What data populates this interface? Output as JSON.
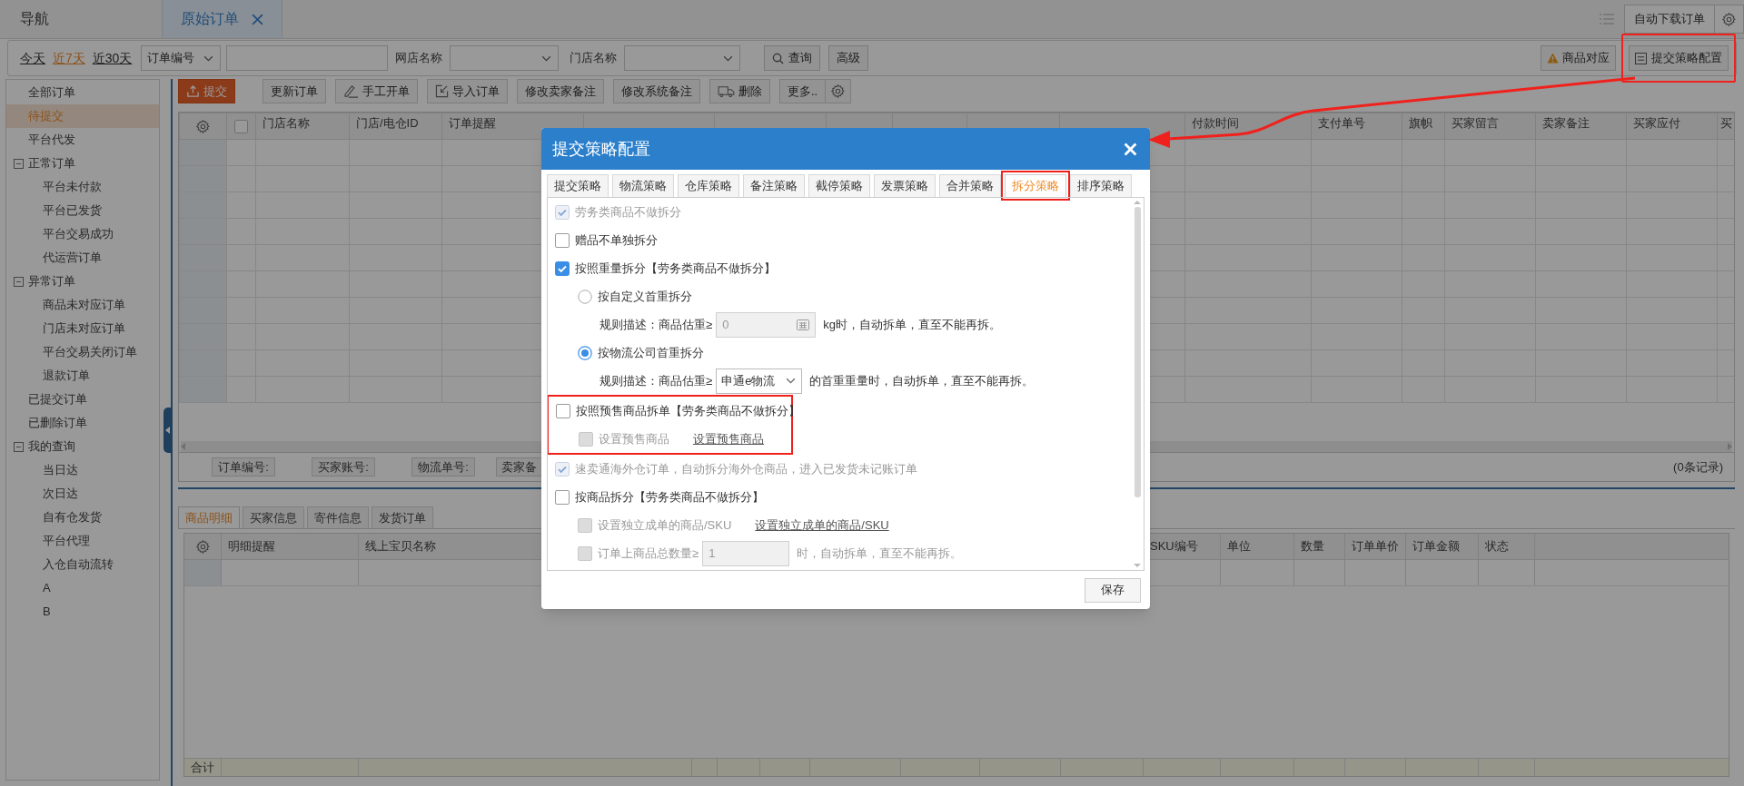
{
  "top_tabs": [
    {
      "label": "导航",
      "selected": false,
      "closable": false
    },
    {
      "label": "原始订单",
      "selected": true,
      "closable": true
    }
  ],
  "top_right": {
    "download_button": "自动下载订单"
  },
  "filter_bar": {
    "date_ranges": [
      {
        "label": "今天",
        "selected": false
      },
      {
        "label": "近7天",
        "selected": true
      },
      {
        "label": "近30天",
        "selected": false
      }
    ],
    "search_type": "订单编号",
    "shop_label": "网店名称",
    "store_label": "门店名称",
    "query_button": "查询",
    "advanced_button": "高级",
    "mapping_button": "商品对应",
    "strategy_button": {
      "label": "提交策略配置",
      "highlighted": true
    }
  },
  "sidebar": {
    "items": [
      {
        "label": "全部订单",
        "selected": false
      },
      {
        "label": "待提交",
        "selected": true
      },
      {
        "label": "平台代发",
        "selected": false
      },
      {
        "label": "正常订单",
        "selected": false,
        "expanded": true,
        "children": [
          {
            "label": "平台未付款",
            "selected": false
          },
          {
            "label": "平台已发货",
            "selected": false
          },
          {
            "label": "平台交易成功",
            "selected": false
          },
          {
            "label": "代运营订单",
            "selected": false
          }
        ]
      },
      {
        "label": "异常订单",
        "selected": false,
        "expanded": true,
        "children": [
          {
            "label": "商品未对应订单",
            "selected": false
          },
          {
            "label": "门店未对应订单",
            "selected": false
          },
          {
            "label": "平台交易关闭订单",
            "selected": false
          },
          {
            "label": "退款订单",
            "selected": false
          }
        ]
      },
      {
        "label": "已提交订单",
        "selected": false
      },
      {
        "label": "已删除订单",
        "selected": false
      },
      {
        "label": "我的查询",
        "selected": false,
        "expanded": true,
        "children": [
          {
            "label": "当日达",
            "selected": false
          },
          {
            "label": "次日达",
            "selected": false
          },
          {
            "label": "自有仓发货",
            "selected": false
          },
          {
            "label": "平台代理",
            "selected": false
          },
          {
            "label": "入仓自动流转",
            "selected": false
          },
          {
            "label": "A",
            "selected": false
          },
          {
            "label": "B",
            "selected": false
          }
        ]
      }
    ]
  },
  "toolbar": [
    {
      "label": "提交",
      "kind": "primary"
    },
    {
      "label": "更新订单",
      "kind": "plain"
    },
    {
      "label": "手工开单",
      "kind": "pen"
    },
    {
      "label": "导入订单",
      "kind": "import"
    },
    {
      "label": "修改卖家备注",
      "kind": "plain"
    },
    {
      "label": "修改系统备注",
      "kind": "plain"
    },
    {
      "label": "删除",
      "kind": "delete"
    },
    {
      "label": "更多..",
      "kind": "plain"
    }
  ],
  "order_table": {
    "select_all": {
      "checked": false
    },
    "columns_left": [
      "门店名称",
      "门店/电仓ID",
      "订单提醒"
    ],
    "columns_right": [
      "付款时间",
      "支付单号",
      "旗帜",
      "买家留言",
      "卖家备注",
      "买家应付",
      "买"
    ],
    "filters": [
      "订单编号:",
      "买家账号:",
      "物流单号:",
      "卖家备"
    ],
    "record_count": "(0条记录)"
  },
  "detail_tabs": [
    {
      "label": "商品明细",
      "selected": true
    },
    {
      "label": "买家信息",
      "selected": false
    },
    {
      "label": "寄件信息",
      "selected": false
    },
    {
      "label": "发货订单",
      "selected": false
    }
  ],
  "detail_table": {
    "columns": [
      "明细提醒",
      "线上宝贝名称",
      "SKU编号",
      "单位",
      "数量",
      "订单单价",
      "订单金额",
      "状态"
    ],
    "footer": "合计"
  },
  "dialog": {
    "title": "提交策略配置",
    "tabs": [
      {
        "label": "提交策略",
        "selected": false,
        "highlighted": false
      },
      {
        "label": "物流策略",
        "selected": false,
        "highlighted": false
      },
      {
        "label": "仓库策略",
        "selected": false,
        "highlighted": false
      },
      {
        "label": "备注策略",
        "selected": false,
        "highlighted": false
      },
      {
        "label": "截停策略",
        "selected": false,
        "highlighted": false
      },
      {
        "label": "发票策略",
        "selected": false,
        "highlighted": false
      },
      {
        "label": "合并策略",
        "selected": false,
        "highlighted": false
      },
      {
        "label": "拆分策略",
        "selected": true,
        "highlighted": true
      },
      {
        "label": "排序策略",
        "selected": false,
        "highlighted": false
      }
    ],
    "options": [
      {
        "kind": "checkbox",
        "label": "劳务类商品不做拆分",
        "checked": true,
        "disabled": true
      },
      {
        "kind": "checkbox",
        "label": "赠品不单独拆分",
        "checked": false,
        "disabled": false
      },
      {
        "kind": "checkbox",
        "label": "按照重量拆分【劳务类商品不做拆分】",
        "checked": true,
        "disabled": false
      },
      {
        "kind": "radio",
        "label": "按自定义首重拆分",
        "selected": false
      },
      {
        "kind": "rule",
        "prefix": "规则描述：商品估重≥",
        "field": {
          "kind": "number",
          "value": "0",
          "disabled": true
        },
        "suffix": "kg时，自动拆单，直至不能再拆。"
      },
      {
        "kind": "radio",
        "label": "按物流公司首重拆分",
        "selected": true
      },
      {
        "kind": "rule",
        "prefix": "规则描述：商品估重≥",
        "field": {
          "kind": "select",
          "value": "申通e物流",
          "disabled": false
        },
        "suffix": "的首重重量时，自动拆单，直至不能再拆。"
      },
      {
        "kind": "group",
        "highlighted": true,
        "children": [
          {
            "kind": "checkbox",
            "label": "按照预售商品拆单【劳务类商品不做拆分】",
            "checked": false,
            "disabled": false
          },
          {
            "kind": "sub_checkbox",
            "label": "设置预售商品",
            "checked": false,
            "disabled": true,
            "link": "设置预售商品"
          }
        ]
      },
      {
        "kind": "checkbox",
        "label": "速卖通海外仓订单，自动拆分海外仓商品，进入已发货未记账订单",
        "checked": true,
        "disabled": true
      },
      {
        "kind": "checkbox",
        "label": "按商品拆分【劳务类商品不做拆分】",
        "checked": false,
        "disabled": false
      },
      {
        "kind": "sub_checkbox",
        "label": "设置独立成单的商品/SKU",
        "checked": false,
        "disabled": true,
        "link": "设置独立成单的商品/SKU"
      },
      {
        "kind": "sub_rule",
        "checked": false,
        "disabled": true,
        "prefix": "订单上商品总数量≥",
        "field": {
          "kind": "plain",
          "value": "1",
          "disabled": true
        },
        "suffix": "时，自动拆单，直至不能再拆。"
      }
    ],
    "save_button": "保存"
  }
}
